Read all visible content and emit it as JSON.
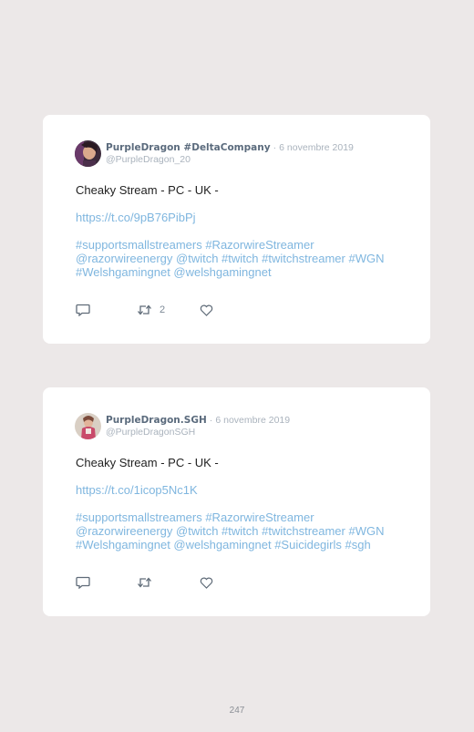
{
  "tweets": [
    {
      "display_name": "PurpleDragon #DeltaCompany",
      "separator": "·",
      "date": "6 novembre 2019",
      "handle": "@PurpleDragon_20",
      "text_lines": {
        "main": "Cheaky Stream - PC - UK -",
        "url": "https://t.co/9pB76PibPj",
        "tags_1": "#supportsmallstreamers #RazorwireStreamer",
        "tags_2": "@razorwireenergy @twitch #twitch #twitchstreamer #WGN",
        "tags_3": "#Welshgamingnet @welshgamingnet"
      },
      "reply_count": "",
      "retweet_count": "2",
      "like_count": ""
    },
    {
      "display_name": "PurpleDragon.SGH",
      "separator": "·",
      "date": "6 novembre 2019",
      "handle": "@PurpleDragonSGH",
      "text_lines": {
        "main": "Cheaky Stream - PC - UK -",
        "url": "https://t.co/1icop5Nc1K",
        "tags_1": "#supportsmallstreamers #RazorwireStreamer",
        "tags_2": "@razorwireenergy @twitch #twitch #twitchstreamer #WGN",
        "tags_3": "#Welshgamingnet @welshgamingnet #Suicidegirls #sgh"
      },
      "reply_count": "",
      "retweet_count": "",
      "like_count": ""
    }
  ],
  "icons": {
    "reply": "reply-icon",
    "retweet": "retweet-icon",
    "like": "heart-icon"
  },
  "colors": {
    "link": "#7fb6df",
    "name": "#5b6b7d",
    "muted": "#aab3bd",
    "background": "#ece8e8"
  },
  "page_number": "247"
}
